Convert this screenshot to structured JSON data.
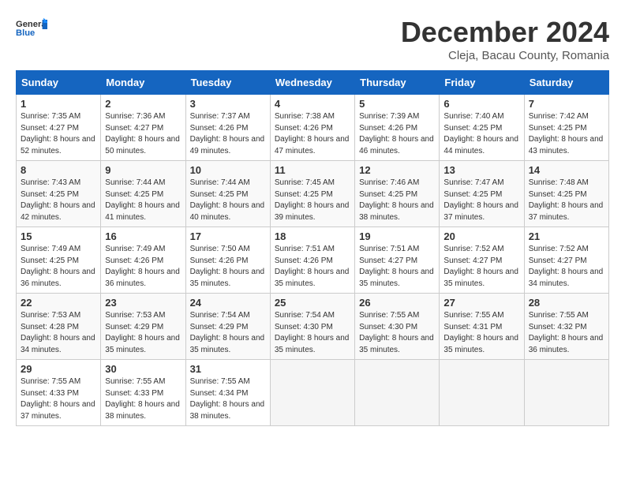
{
  "header": {
    "logo_general": "General",
    "logo_blue": "Blue",
    "month": "December 2024",
    "location": "Cleja, Bacau County, Romania"
  },
  "days_of_week": [
    "Sunday",
    "Monday",
    "Tuesday",
    "Wednesday",
    "Thursday",
    "Friday",
    "Saturday"
  ],
  "weeks": [
    [
      {
        "num": "1",
        "sunrise": "7:35 AM",
        "sunset": "4:27 PM",
        "daylight": "8 hours and 52 minutes."
      },
      {
        "num": "2",
        "sunrise": "7:36 AM",
        "sunset": "4:27 PM",
        "daylight": "8 hours and 50 minutes."
      },
      {
        "num": "3",
        "sunrise": "7:37 AM",
        "sunset": "4:26 PM",
        "daylight": "8 hours and 49 minutes."
      },
      {
        "num": "4",
        "sunrise": "7:38 AM",
        "sunset": "4:26 PM",
        "daylight": "8 hours and 47 minutes."
      },
      {
        "num": "5",
        "sunrise": "7:39 AM",
        "sunset": "4:26 PM",
        "daylight": "8 hours and 46 minutes."
      },
      {
        "num": "6",
        "sunrise": "7:40 AM",
        "sunset": "4:25 PM",
        "daylight": "8 hours and 44 minutes."
      },
      {
        "num": "7",
        "sunrise": "7:42 AM",
        "sunset": "4:25 PM",
        "daylight": "8 hours and 43 minutes."
      }
    ],
    [
      {
        "num": "8",
        "sunrise": "7:43 AM",
        "sunset": "4:25 PM",
        "daylight": "8 hours and 42 minutes."
      },
      {
        "num": "9",
        "sunrise": "7:44 AM",
        "sunset": "4:25 PM",
        "daylight": "8 hours and 41 minutes."
      },
      {
        "num": "10",
        "sunrise": "7:44 AM",
        "sunset": "4:25 PM",
        "daylight": "8 hours and 40 minutes."
      },
      {
        "num": "11",
        "sunrise": "7:45 AM",
        "sunset": "4:25 PM",
        "daylight": "8 hours and 39 minutes."
      },
      {
        "num": "12",
        "sunrise": "7:46 AM",
        "sunset": "4:25 PM",
        "daylight": "8 hours and 38 minutes."
      },
      {
        "num": "13",
        "sunrise": "7:47 AM",
        "sunset": "4:25 PM",
        "daylight": "8 hours and 37 minutes."
      },
      {
        "num": "14",
        "sunrise": "7:48 AM",
        "sunset": "4:25 PM",
        "daylight": "8 hours and 37 minutes."
      }
    ],
    [
      {
        "num": "15",
        "sunrise": "7:49 AM",
        "sunset": "4:25 PM",
        "daylight": "8 hours and 36 minutes."
      },
      {
        "num": "16",
        "sunrise": "7:49 AM",
        "sunset": "4:26 PM",
        "daylight": "8 hours and 36 minutes."
      },
      {
        "num": "17",
        "sunrise": "7:50 AM",
        "sunset": "4:26 PM",
        "daylight": "8 hours and 35 minutes."
      },
      {
        "num": "18",
        "sunrise": "7:51 AM",
        "sunset": "4:26 PM",
        "daylight": "8 hours and 35 minutes."
      },
      {
        "num": "19",
        "sunrise": "7:51 AM",
        "sunset": "4:27 PM",
        "daylight": "8 hours and 35 minutes."
      },
      {
        "num": "20",
        "sunrise": "7:52 AM",
        "sunset": "4:27 PM",
        "daylight": "8 hours and 35 minutes."
      },
      {
        "num": "21",
        "sunrise": "7:52 AM",
        "sunset": "4:27 PM",
        "daylight": "8 hours and 34 minutes."
      }
    ],
    [
      {
        "num": "22",
        "sunrise": "7:53 AM",
        "sunset": "4:28 PM",
        "daylight": "8 hours and 34 minutes."
      },
      {
        "num": "23",
        "sunrise": "7:53 AM",
        "sunset": "4:29 PM",
        "daylight": "8 hours and 35 minutes."
      },
      {
        "num": "24",
        "sunrise": "7:54 AM",
        "sunset": "4:29 PM",
        "daylight": "8 hours and 35 minutes."
      },
      {
        "num": "25",
        "sunrise": "7:54 AM",
        "sunset": "4:30 PM",
        "daylight": "8 hours and 35 minutes."
      },
      {
        "num": "26",
        "sunrise": "7:55 AM",
        "sunset": "4:30 PM",
        "daylight": "8 hours and 35 minutes."
      },
      {
        "num": "27",
        "sunrise": "7:55 AM",
        "sunset": "4:31 PM",
        "daylight": "8 hours and 35 minutes."
      },
      {
        "num": "28",
        "sunrise": "7:55 AM",
        "sunset": "4:32 PM",
        "daylight": "8 hours and 36 minutes."
      }
    ],
    [
      {
        "num": "29",
        "sunrise": "7:55 AM",
        "sunset": "4:33 PM",
        "daylight": "8 hours and 37 minutes."
      },
      {
        "num": "30",
        "sunrise": "7:55 AM",
        "sunset": "4:33 PM",
        "daylight": "8 hours and 38 minutes."
      },
      {
        "num": "31",
        "sunrise": "7:55 AM",
        "sunset": "4:34 PM",
        "daylight": "8 hours and 38 minutes."
      },
      null,
      null,
      null,
      null
    ]
  ]
}
